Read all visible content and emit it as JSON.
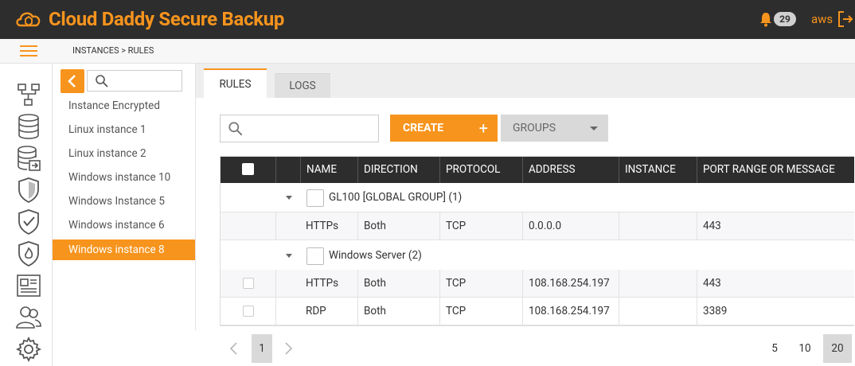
{
  "app": {
    "title": "Cloud Daddy Secure Backup",
    "notification_count": "29",
    "user": "aws",
    "accent_color": "#f7941d"
  },
  "breadcrumb": "INSTANCES > RULES",
  "rail_icons": [
    "network-icon",
    "database-icon",
    "database-export-icon",
    "shield-icon",
    "shield-check-icon",
    "shield-fire-icon",
    "newspaper-icon",
    "users-icon",
    "settings-gear-icon"
  ],
  "instances": {
    "search_placeholder": "",
    "items": [
      {
        "label": "Instance Encrypted",
        "active": false
      },
      {
        "label": "Linux instance 1",
        "active": false
      },
      {
        "label": "Linux instance 2",
        "active": false
      },
      {
        "label": "Windows instance 10",
        "active": false
      },
      {
        "label": "Windows Instance 5",
        "active": false
      },
      {
        "label": "Windows instance 6",
        "active": false
      },
      {
        "label": "Windows instance 8",
        "active": true
      }
    ]
  },
  "tabs": [
    {
      "label": "RULES",
      "active": true
    },
    {
      "label": "LOGS",
      "active": false
    }
  ],
  "toolbar": {
    "search_placeholder": "",
    "create_label": "CREATE",
    "create_icon": "+",
    "groups_label": "GROUPS"
  },
  "table": {
    "columns": [
      "NAME",
      "DIRECTION",
      "PROTOCOL",
      "ADDRESS",
      "INSTANCE",
      "PORT RANGE OR MESSAGE"
    ],
    "groups": [
      {
        "label": "GL100 [GLOBAL GROUP] (1)",
        "rows": [
          {
            "name": "HTTPs",
            "direction": "Both",
            "protocol": "TCP",
            "address": "0.0.0.0",
            "instance": "",
            "port": "443"
          }
        ]
      },
      {
        "label": "Windows Server (2)",
        "rows": [
          {
            "name": "HTTPs",
            "direction": "Both",
            "protocol": "TCP",
            "address": "108.168.254.197",
            "instance": "",
            "port": "443"
          },
          {
            "name": "RDP",
            "direction": "Both",
            "protocol": "TCP",
            "address": "108.168.254.197",
            "instance": "",
            "port": "3389"
          }
        ]
      }
    ]
  },
  "pager": {
    "current_page": "1",
    "page_sizes": [
      "5",
      "10",
      "20"
    ],
    "selected_size": "20"
  }
}
